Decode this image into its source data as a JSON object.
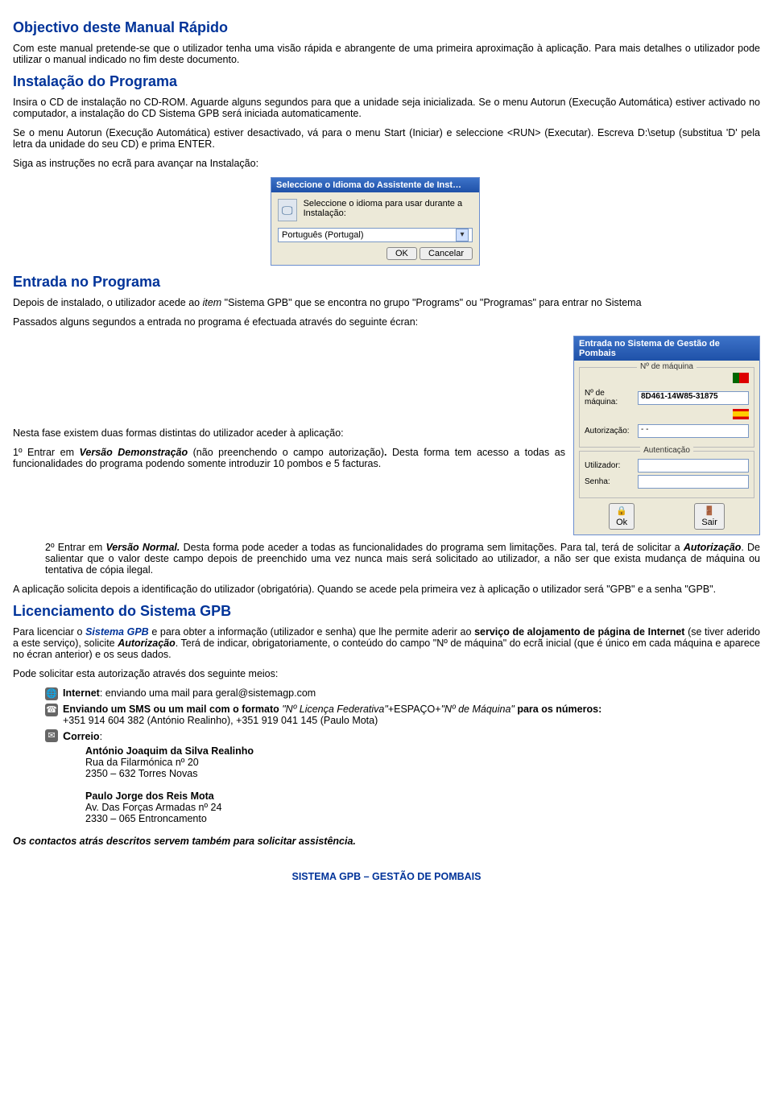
{
  "h_obj": "Objectivo deste Manual Rápido",
  "p_obj1": "Com este manual pretende-se que o utilizador tenha uma visão rápida e abrangente de uma primeira aproximação à aplicação. Para mais detalhes o utilizador pode utilizar o manual indicado no fim deste documento.",
  "h_instal": "Instalação do Programa",
  "p_instal1": "Insira o CD de instalação no CD-ROM. Aguarde alguns segundos para que a unidade seja inicializada. Se o menu Autorun (Execução Automática) estiver activado no computador, a instalação do CD Sistema GPB será iniciada automaticamente.",
  "p_instal2": "Se o menu Autorun (Execução Automática) estiver desactivado, vá para o menu Start (Iniciar) e seleccione <RUN> (Executar). Escreva D:\\setup (substitua 'D' pela letra da unidade do seu CD) e prima ENTER.",
  "p_instal3": "Siga as instruções no ecrã para avançar na Instalação:",
  "dlg1": {
    "title": "Seleccione o Idioma do Assistente de Inst…",
    "text": "Seleccione o idioma para usar durante a Instalação:",
    "selected": "Português (Portugal)",
    "ok": "OK",
    "cancel": "Cancelar"
  },
  "h_entrada": "Entrada no Programa",
  "p_entrada1a": "Depois de instalado, o utilizador acede ao ",
  "p_entrada1b": "item",
  "p_entrada1c": " \"Sistema GPB\" que se encontra no grupo \"Programs\" ou \"Programas\" para entrar no Sistema",
  "p_entrada2": "Passados alguns segundos a entrada no programa é efectuada através do seguinte écran:",
  "dlg2": {
    "title": "Entrada no Sistema de Gestão de Pombais",
    "grp1": "Nº de máquina",
    "lab_maq": "Nº de máquina:",
    "val_maq": "8D461-14W85-31875",
    "lab_auth": "Autorização:",
    "dash": "-     -",
    "grp2": "Autenticação",
    "lab_user": "Utilizador:",
    "lab_pass": "Senha:",
    "ok": "Ok",
    "sair": "Sair"
  },
  "p_fases": "Nesta fase existem duas formas distintas do utilizador aceder à aplicação:",
  "p_1a": "1º  Entrar em ",
  "p_1b": "Versão Demonstração",
  "p_1c": " (não preenchendo o campo autorização)",
  "p_1d": ". ",
  "p_1e": "Desta forma tem acesso a todas as funcionalidades do programa podendo somente introduzir 10 pombos e 5 facturas.",
  "p_2a": "2º  Entrar em ",
  "p_2b": "Versão Normal.",
  "p_2c": " Desta forma pode aceder a todas as funcionalidades do programa sem limitações. Para tal, terá de solicitar  a ",
  "p_2d": "Autorização",
  "p_2e": ". De salientar que o valor deste campo depois de preenchido uma vez nunca mais será solicitado ao utilizador, a não ser que exista mudança de máquina ou tentativa de cópia ilegal.",
  "p_ident": "A aplicação solicita depois a identificação do utilizador (obrigatória). Quando se acede pela primeira vez à aplicação o utilizador será \"GPB\" e a senha \"GPB\".",
  "h_lic": "Licenciamento do Sistema GPB",
  "p_lic_a": "Para licenciar o ",
  "p_lic_b": "Sistema GPB",
  "p_lic_c": " e para obter a informação (utilizador e senha) que lhe permite aderir ao ",
  "p_lic_d": "serviço de alojamento de página de Internet",
  "p_lic_e": " (se tiver aderido a este serviço), solicite ",
  "p_lic_f": "Autorização",
  "p_lic_g": ". Terá de indicar, obrigatoriamente, o conteúdo do campo \"Nº de máquina\" do ecrã inicial (que é único em cada máquina e aparece no écran anterior) e os seus dados.",
  "p_solic": "Pode solicitar esta autorização através dos seguinte meios:",
  "c_net_a": "Internet",
  "c_net_b": ": enviando uma mail para geral@sistemagp.com",
  "c_sms_a": "Enviando um SMS ou um mail com o formato ",
  "c_sms_b": "\"Nº Licença Federativa\"",
  "c_sms_c": "+ESPAÇO+",
  "c_sms_d": "\"Nº de Máquina\"",
  "c_sms_e": " para os números:",
  "c_sms_f": "+351 914 604 382 (António Realinho), +351 919 041 145 (Paulo Mota)",
  "c_correio_a": "C",
  "c_correio_b": "orreio",
  "c_correio_c": ":",
  "addr1a": "António Joaquim da Silva Realinho",
  "addr1b": "Rua da Filarmónica nº 20",
  "addr1c": "2350 – 632 Torres Novas",
  "addr2a": "Paulo Jorge dos Reis Mota",
  "addr2b": "Av. Das Forças Armadas nº 24",
  "addr2c": "2330 – 065 Entroncamento",
  "p_assist": "Os contactos atrás descritos servem também para solicitar assistência.",
  "footer": "SISTEMA GPB – GESTÃO DE POMBAIS"
}
